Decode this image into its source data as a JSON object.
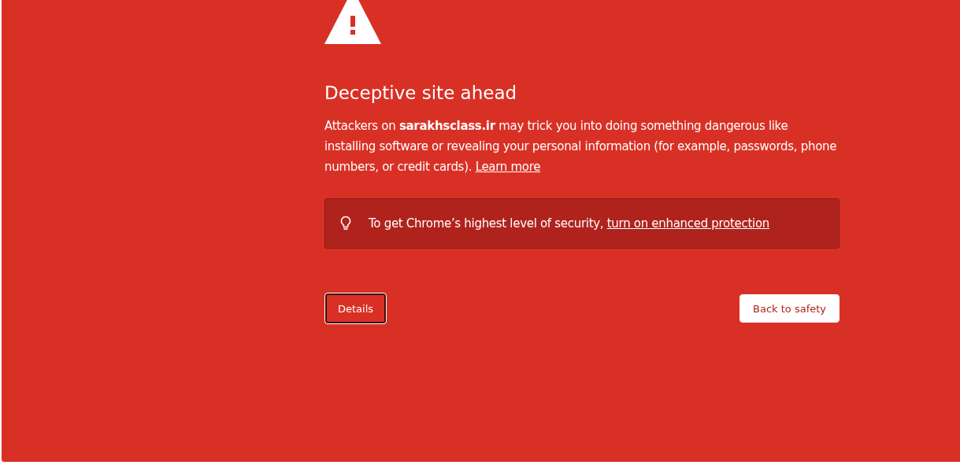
{
  "heading": "Deceptive site ahead",
  "message": {
    "text": "Attackers on **sarakhsclass.ir** may trick you into doing something dangerous like installing software or revealing your personal information (for example, passwords, phone numbers, or credit cards).",
    "link": "Learn more"
  },
  "notice": {
    "text": "To get Chrome’s highest level of security,",
    "link": "turn on enhanced protection"
  },
  "buttons": [
    {
      "label": "Details",
      "kind": "secondary",
      "focused": true
    },
    {
      "label": "Back to safety",
      "kind": "primary",
      "focused": false
    }
  ]
}
